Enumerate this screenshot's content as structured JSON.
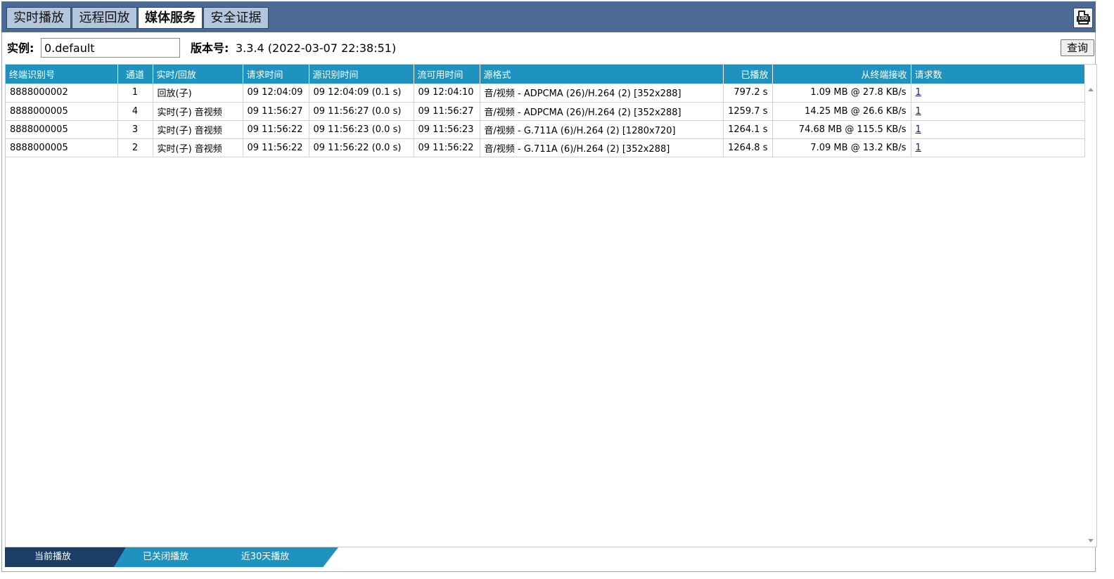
{
  "top_tabs": [
    {
      "label": "实时播放"
    },
    {
      "label": "远程回放"
    },
    {
      "label": "媒体服务"
    },
    {
      "label": "安全证据"
    }
  ],
  "log_button": {
    "icon": "log-file-icon",
    "text": "LOG"
  },
  "info": {
    "instance_label": "实例:",
    "instance_value": "0.default",
    "version_label": "版本号:",
    "version_value": "3.3.4 (2022-03-07 22:38:51)",
    "query_label": "查询"
  },
  "table": {
    "headers": [
      "终端识别号",
      "通道",
      "实时/回放",
      "请求时间",
      "源识别时间",
      "流可用时间",
      "源格式",
      "已播放",
      "从终端接收",
      "请求数"
    ],
    "rows": [
      {
        "terminal": "8888000002",
        "channel": "1",
        "mode": "回放(子)",
        "req_time": "09 12:04:09",
        "src_time": "09 12:04:09 (0.1 s)",
        "avail_time": "09 12:04:10",
        "format": "音/视频 - ADPCMA (26)/H.264 (2) [352x288]",
        "played": "797.2 s",
        "received": "1.09 MB @ 27.8 KB/s",
        "requests": "1"
      },
      {
        "terminal": "8888000005",
        "channel": "4",
        "mode": "实时(子) 音视频",
        "req_time": "09 11:56:27",
        "src_time": "09 11:56:27 (0.0 s)",
        "avail_time": "09 11:56:27",
        "format": "音/视频 - ADPCMA (26)/H.264 (2) [352x288]",
        "played": "1259.7 s",
        "received": "14.25 MB @ 26.6 KB/s",
        "requests": "1"
      },
      {
        "terminal": "8888000005",
        "channel": "3",
        "mode": "实时(子) 音视频",
        "req_time": "09 11:56:22",
        "src_time": "09 11:56:23 (0.0 s)",
        "avail_time": "09 11:56:23",
        "format": "音/视频 - G.711A (6)/H.264 (2) [1280x720]",
        "played": "1264.1 s",
        "received": "74.68 MB @ 115.5 KB/s",
        "requests": "1"
      },
      {
        "terminal": "8888000005",
        "channel": "2",
        "mode": "实时(子) 音视频",
        "req_time": "09 11:56:22",
        "src_time": "09 11:56:22 (0.0 s)",
        "avail_time": "09 11:56:22",
        "format": "音/视频 - G.711A (6)/H.264 (2) [352x288]",
        "played": "1264.8 s",
        "received": "7.09 MB @ 13.2 KB/s",
        "requests": "1"
      }
    ]
  },
  "bottom_tabs": [
    {
      "label": "当前播放"
    },
    {
      "label": "已关闭播放"
    },
    {
      "label": "近30天播放"
    }
  ],
  "colors": {
    "header_bar": "#4b6a95",
    "table_header": "#1f93c0",
    "active_bottom_tab": "#1c3e66"
  }
}
